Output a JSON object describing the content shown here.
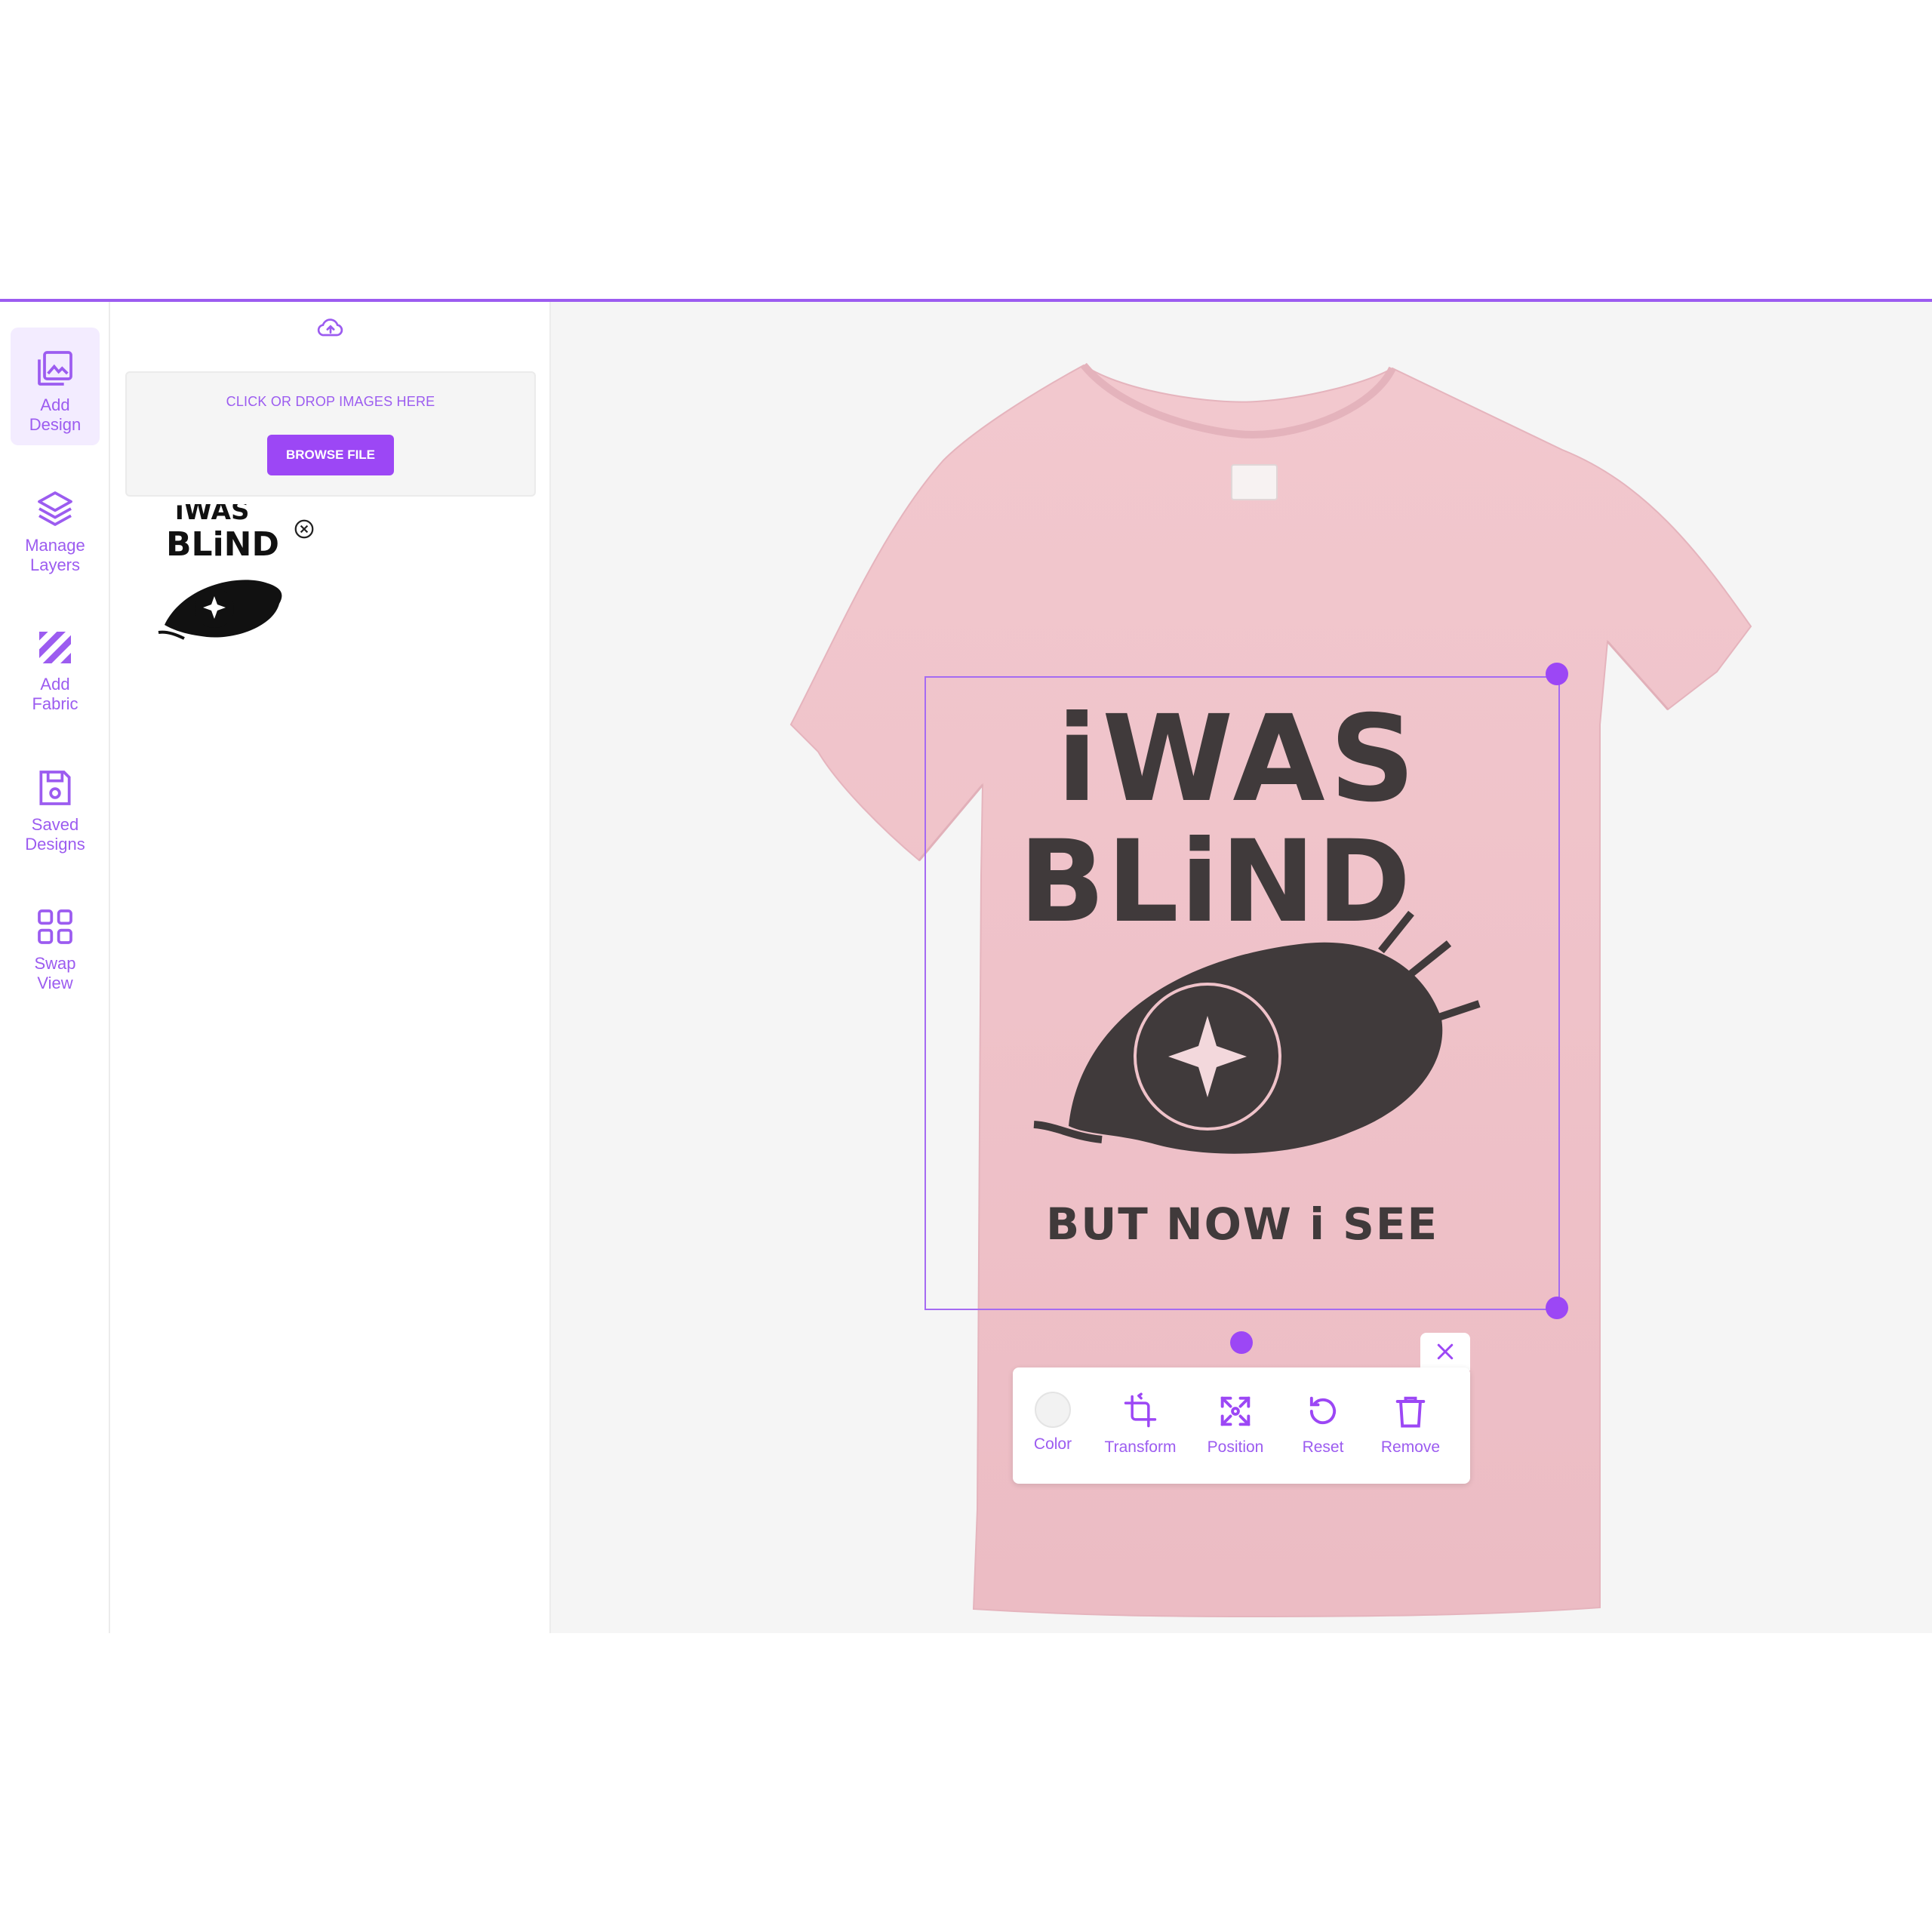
{
  "sidebar": {
    "items": [
      {
        "label_1": "Add",
        "label_2": "Design",
        "icon": "add-design-icon",
        "active": true
      },
      {
        "label_1": "Manage",
        "label_2": "Layers",
        "icon": "layers-icon"
      },
      {
        "label_1": "Add",
        "label_2": "Fabric",
        "icon": "fabric-icon"
      },
      {
        "label_1": "Saved",
        "label_2": "Designs",
        "icon": "save-icon"
      },
      {
        "label_1": "Swap",
        "label_2": "View",
        "icon": "grid-icon"
      }
    ]
  },
  "upload": {
    "drop_text": "CLICK OR DROP IMAGES HERE",
    "browse_label": "BROWSE FILE"
  },
  "design": {
    "line1": "iWAS",
    "line2": "BLiND",
    "line3": "BUT NOW i SEE"
  },
  "thumbnail": {
    "line1": "iWAS",
    "line2": "BLiND"
  },
  "toolbar": {
    "color_label": "Color",
    "transform_label": "Transform",
    "position_label": "Position",
    "reset_label": "Reset",
    "remove_label": "Remove"
  },
  "colors": {
    "accent": "#9c47f5",
    "shirt": "#efc2c9",
    "ink": "#3f3a3b"
  }
}
